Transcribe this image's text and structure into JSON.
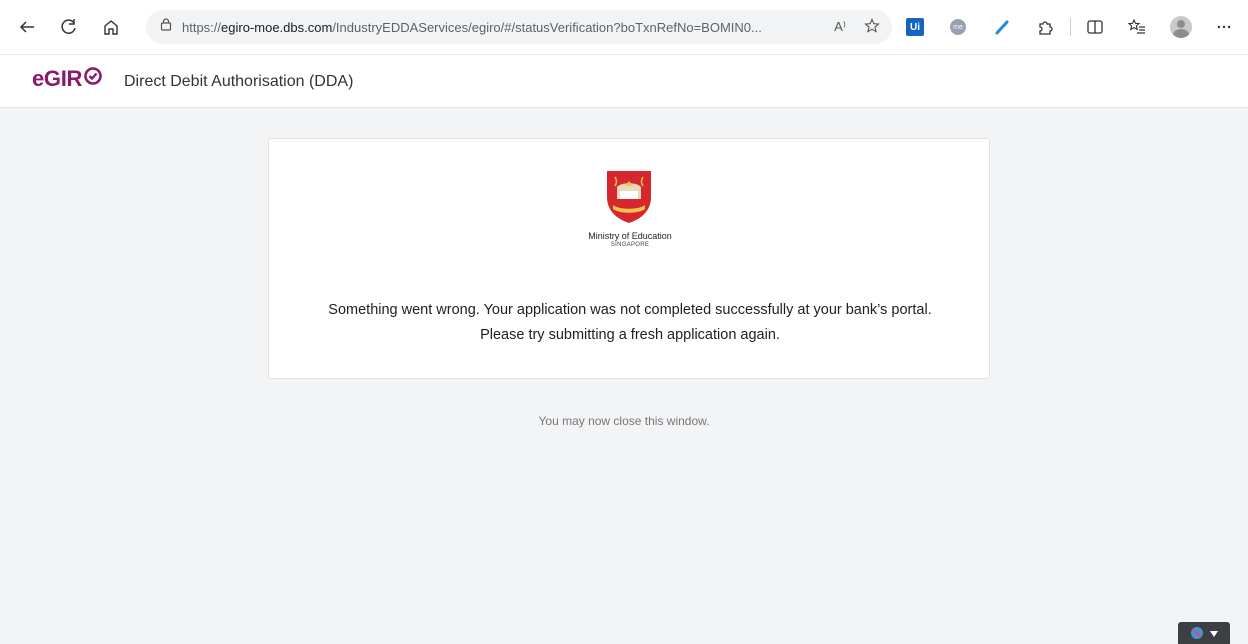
{
  "browser": {
    "url_prefix": "https://",
    "url_host": "egiro-moe.dbs.com",
    "url_path": "/IndustryEDDAServices/egiro/#/statusVerification?boTxnRefNo=BOMIN0...",
    "read_aloud_label": "A⁾",
    "ext_ui_label": "Ui",
    "ext_me_label": "me"
  },
  "header": {
    "logo_prefix": "eGIR",
    "title": "Direct Debit Authorisation (DDA)"
  },
  "card": {
    "org_name": "Ministry of Education",
    "org_sub": "SINGAPORE",
    "message_line1": "Something went wrong. Your application was not completed successfully at your bank’s portal.",
    "message_line2": "Please try submitting a fresh application again."
  },
  "footer_note": "You may now close this window.",
  "colors": {
    "brand": "#8a1a6b",
    "crest_red": "#d6262e",
    "background": "#f3f4f6"
  }
}
